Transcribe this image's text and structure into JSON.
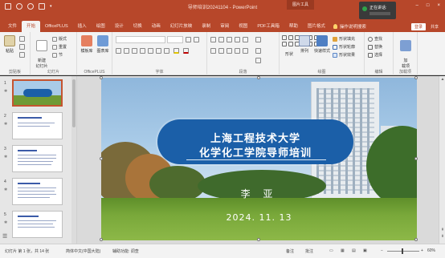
{
  "titlebar": {
    "doc_title": "导师培训20241104 - PowerPoint",
    "context_tab_group": "图片工具",
    "speaking_label": "正在讲话:",
    "login": "登录",
    "share": "共享"
  },
  "tabs": [
    "文件",
    "开始",
    "OfficePLUS",
    "插入",
    "绘图",
    "设计",
    "切换",
    "动画",
    "幻灯片放映",
    "录制",
    "审阅",
    "视图",
    "PDF工具箱",
    "帮助",
    "图片格式"
  ],
  "active_tab": "开始",
  "tell_me": "操作说明搜索",
  "ribbon": {
    "clipboard": {
      "label": "剪贴板",
      "paste": "粘贴"
    },
    "slides": {
      "label": "幻灯片",
      "new_slide": "新建\n幻灯片",
      "layout": "版式",
      "reset": "重置",
      "section": "节"
    },
    "officeplus": {
      "label": "OfficePLUS",
      "btn1": "模板库",
      "btn2": "图表库"
    },
    "font": {
      "label": "字体"
    },
    "paragraph": {
      "label": "段落"
    },
    "drawing": {
      "label": "绘图",
      "shapes": "形状",
      "arrange": "排列",
      "quick_styles": "快速样式",
      "fill": "形状填充",
      "outline": "形状轮廓",
      "effects": "形状效果"
    },
    "editing": {
      "label": "编辑",
      "find": "查找",
      "replace": "替换",
      "select": "选择"
    },
    "addins": {
      "label": "加载项",
      "btn": "加\n载项"
    }
  },
  "thumbnails": [
    "1",
    "2",
    "3",
    "4",
    "5"
  ],
  "slide": {
    "title_line1": "上海工程技术大学",
    "title_line2": "化学化工学院导师培训",
    "presenter": "李 亚",
    "date": "2024. 11. 13"
  },
  "statusbar": {
    "slide_info": "幻灯片 第 1 张，共 14 张",
    "language": "简体中文(中国大陆)",
    "accessibility": "辅助功能: 调查",
    "notes": "备注",
    "comments": "批注",
    "zoom": "60%"
  },
  "colors": {
    "accent": "#b7472a",
    "banner": "#1b5fa8"
  }
}
